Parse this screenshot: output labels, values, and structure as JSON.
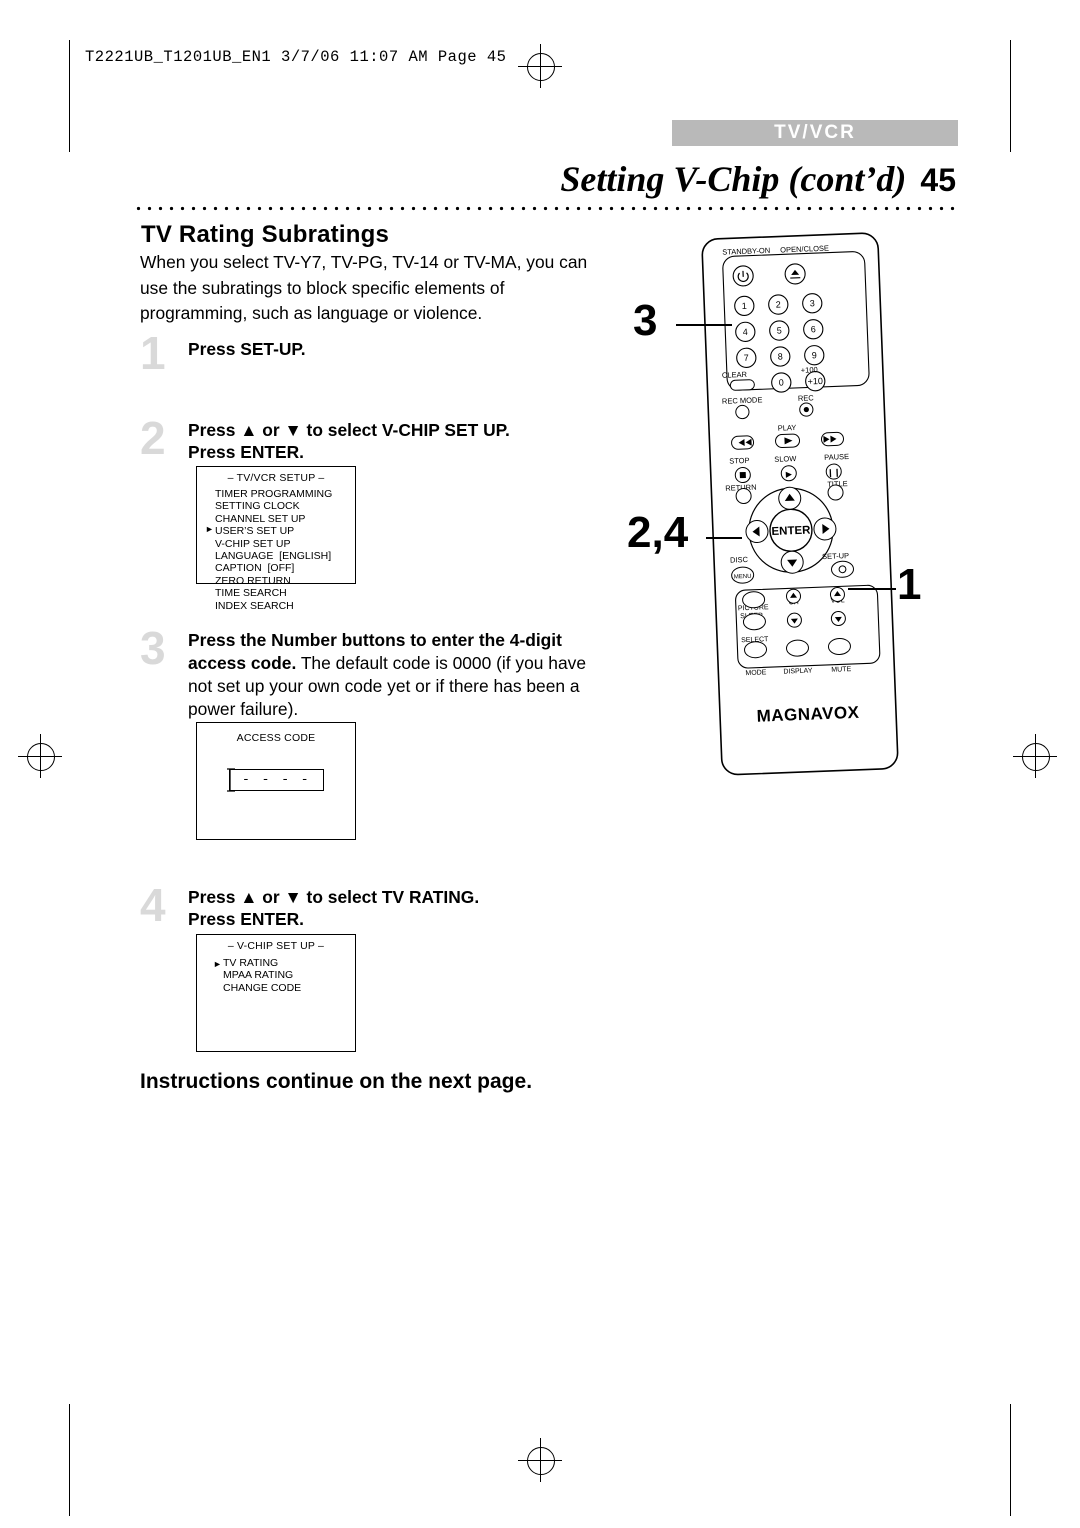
{
  "slug": "T2221UB_T1201UB_EN1  3/7/06  11:07 AM  Page 45",
  "header": {
    "tab_label": "TV/VCR",
    "title": "Setting V-Chip (cont’d)",
    "page_number": "45"
  },
  "content": {
    "section_heading": "TV Rating Subratings",
    "intro": "When you select TV-Y7, TV-PG, TV-14 or TV-MA, you can use the subratings to block specific elements of programming, such as language or violence.",
    "steps": [
      {
        "num": "1",
        "text": "Press SET-UP."
      },
      {
        "num": "2",
        "line1": "Press ▲ or ▼ to select V-CHIP SET UP.",
        "line2": "Press ENTER."
      },
      {
        "num": "3",
        "bold": "Press the Number buttons to enter the 4-digit access code.",
        "rest": " The default code is 0000 (if you have not set up your own code yet or if there has been a power failure)."
      },
      {
        "num": "4",
        "line1": "Press ▲ or ▼ to select TV RATING.",
        "line2": "Press ENTER."
      }
    ],
    "continue_note": "Instructions continue on the next page."
  },
  "osd_setup": {
    "title": "– TV/VCR SETUP –",
    "items": [
      "TIMER PROGRAMMING",
      "SETTING CLOCK",
      "CHANNEL SET UP",
      "USER’S SET UP",
      "V-CHIP SET UP",
      "LANGUAGE  [ENGLISH]",
      "CAPTION  [OFF]",
      "ZERO RETURN",
      "TIME SEARCH",
      "INDEX SEARCH"
    ],
    "cursor_index": 4
  },
  "osd_access": {
    "title": "ACCESS CODE",
    "dashes": "- - - -"
  },
  "osd_vchip": {
    "title": "– V-CHIP SET UP –",
    "items": [
      "TV RATING",
      "MPAA RATING",
      "CHANGE CODE"
    ],
    "cursor_index": 0
  },
  "callouts": [
    {
      "id": "callout-3",
      "label": "3"
    },
    {
      "id": "callout-24",
      "label": "2,4"
    },
    {
      "id": "callout-1",
      "label": "1"
    }
  ],
  "remote": {
    "brand": "MAGNAVOX",
    "labels": {
      "standby": "STANDBY-ON",
      "open_close": "OPEN/CLOSE",
      "clear": "CLEAR",
      "plus100": "+100",
      "rec_mode": "REC MODE",
      "rec": "REC",
      "play": "PLAY",
      "stop": "STOP",
      "slow": "SLOW",
      "pause": "PAUSE",
      "return": "RETURN",
      "title": "TITLE",
      "enter": "ENTER",
      "disc": "DISC",
      "menu": "MENU",
      "setup": "SET-UP",
      "picture": "PICTURE",
      "sleep": "SLEEP",
      "ch": "CH",
      "vol": "VOL",
      "select": "SELECT",
      "mode": "MODE",
      "display": "DISPLAY",
      "mute": "MUTE"
    },
    "number_keys": [
      "1",
      "2",
      "3",
      "4",
      "5",
      "6",
      "7",
      "8",
      "9",
      "0"
    ],
    "plus10": "+10"
  }
}
